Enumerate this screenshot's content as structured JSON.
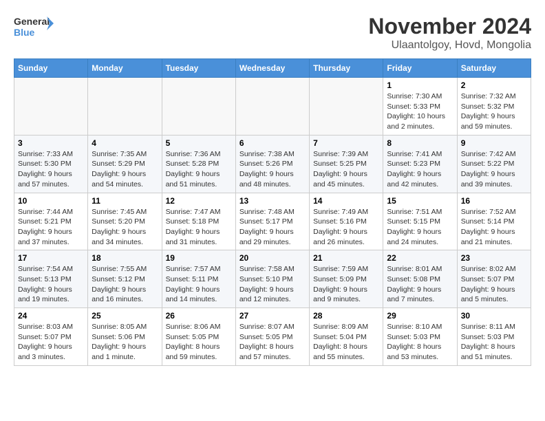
{
  "header": {
    "logo_line1": "General",
    "logo_line2": "Blue",
    "title": "November 2024",
    "subtitle": "Ulaantolgoy, Hovd, Mongolia"
  },
  "days_of_week": [
    "Sunday",
    "Monday",
    "Tuesday",
    "Wednesday",
    "Thursday",
    "Friday",
    "Saturday"
  ],
  "weeks": [
    [
      {
        "day": "",
        "info": ""
      },
      {
        "day": "",
        "info": ""
      },
      {
        "day": "",
        "info": ""
      },
      {
        "day": "",
        "info": ""
      },
      {
        "day": "",
        "info": ""
      },
      {
        "day": "1",
        "info": "Sunrise: 7:30 AM\nSunset: 5:33 PM\nDaylight: 10 hours\nand 2 minutes."
      },
      {
        "day": "2",
        "info": "Sunrise: 7:32 AM\nSunset: 5:32 PM\nDaylight: 9 hours\nand 59 minutes."
      }
    ],
    [
      {
        "day": "3",
        "info": "Sunrise: 7:33 AM\nSunset: 5:30 PM\nDaylight: 9 hours\nand 57 minutes."
      },
      {
        "day": "4",
        "info": "Sunrise: 7:35 AM\nSunset: 5:29 PM\nDaylight: 9 hours\nand 54 minutes."
      },
      {
        "day": "5",
        "info": "Sunrise: 7:36 AM\nSunset: 5:28 PM\nDaylight: 9 hours\nand 51 minutes."
      },
      {
        "day": "6",
        "info": "Sunrise: 7:38 AM\nSunset: 5:26 PM\nDaylight: 9 hours\nand 48 minutes."
      },
      {
        "day": "7",
        "info": "Sunrise: 7:39 AM\nSunset: 5:25 PM\nDaylight: 9 hours\nand 45 minutes."
      },
      {
        "day": "8",
        "info": "Sunrise: 7:41 AM\nSunset: 5:23 PM\nDaylight: 9 hours\nand 42 minutes."
      },
      {
        "day": "9",
        "info": "Sunrise: 7:42 AM\nSunset: 5:22 PM\nDaylight: 9 hours\nand 39 minutes."
      }
    ],
    [
      {
        "day": "10",
        "info": "Sunrise: 7:44 AM\nSunset: 5:21 PM\nDaylight: 9 hours\nand 37 minutes."
      },
      {
        "day": "11",
        "info": "Sunrise: 7:45 AM\nSunset: 5:20 PM\nDaylight: 9 hours\nand 34 minutes."
      },
      {
        "day": "12",
        "info": "Sunrise: 7:47 AM\nSunset: 5:18 PM\nDaylight: 9 hours\nand 31 minutes."
      },
      {
        "day": "13",
        "info": "Sunrise: 7:48 AM\nSunset: 5:17 PM\nDaylight: 9 hours\nand 29 minutes."
      },
      {
        "day": "14",
        "info": "Sunrise: 7:49 AM\nSunset: 5:16 PM\nDaylight: 9 hours\nand 26 minutes."
      },
      {
        "day": "15",
        "info": "Sunrise: 7:51 AM\nSunset: 5:15 PM\nDaylight: 9 hours\nand 24 minutes."
      },
      {
        "day": "16",
        "info": "Sunrise: 7:52 AM\nSunset: 5:14 PM\nDaylight: 9 hours\nand 21 minutes."
      }
    ],
    [
      {
        "day": "17",
        "info": "Sunrise: 7:54 AM\nSunset: 5:13 PM\nDaylight: 9 hours\nand 19 minutes."
      },
      {
        "day": "18",
        "info": "Sunrise: 7:55 AM\nSunset: 5:12 PM\nDaylight: 9 hours\nand 16 minutes."
      },
      {
        "day": "19",
        "info": "Sunrise: 7:57 AM\nSunset: 5:11 PM\nDaylight: 9 hours\nand 14 minutes."
      },
      {
        "day": "20",
        "info": "Sunrise: 7:58 AM\nSunset: 5:10 PM\nDaylight: 9 hours\nand 12 minutes."
      },
      {
        "day": "21",
        "info": "Sunrise: 7:59 AM\nSunset: 5:09 PM\nDaylight: 9 hours\nand 9 minutes."
      },
      {
        "day": "22",
        "info": "Sunrise: 8:01 AM\nSunset: 5:08 PM\nDaylight: 9 hours\nand 7 minutes."
      },
      {
        "day": "23",
        "info": "Sunrise: 8:02 AM\nSunset: 5:07 PM\nDaylight: 9 hours\nand 5 minutes."
      }
    ],
    [
      {
        "day": "24",
        "info": "Sunrise: 8:03 AM\nSunset: 5:07 PM\nDaylight: 9 hours\nand 3 minutes."
      },
      {
        "day": "25",
        "info": "Sunrise: 8:05 AM\nSunset: 5:06 PM\nDaylight: 9 hours\nand 1 minute."
      },
      {
        "day": "26",
        "info": "Sunrise: 8:06 AM\nSunset: 5:05 PM\nDaylight: 8 hours\nand 59 minutes."
      },
      {
        "day": "27",
        "info": "Sunrise: 8:07 AM\nSunset: 5:05 PM\nDaylight: 8 hours\nand 57 minutes."
      },
      {
        "day": "28",
        "info": "Sunrise: 8:09 AM\nSunset: 5:04 PM\nDaylight: 8 hours\nand 55 minutes."
      },
      {
        "day": "29",
        "info": "Sunrise: 8:10 AM\nSunset: 5:03 PM\nDaylight: 8 hours\nand 53 minutes."
      },
      {
        "day": "30",
        "info": "Sunrise: 8:11 AM\nSunset: 5:03 PM\nDaylight: 8 hours\nand 51 minutes."
      }
    ]
  ]
}
